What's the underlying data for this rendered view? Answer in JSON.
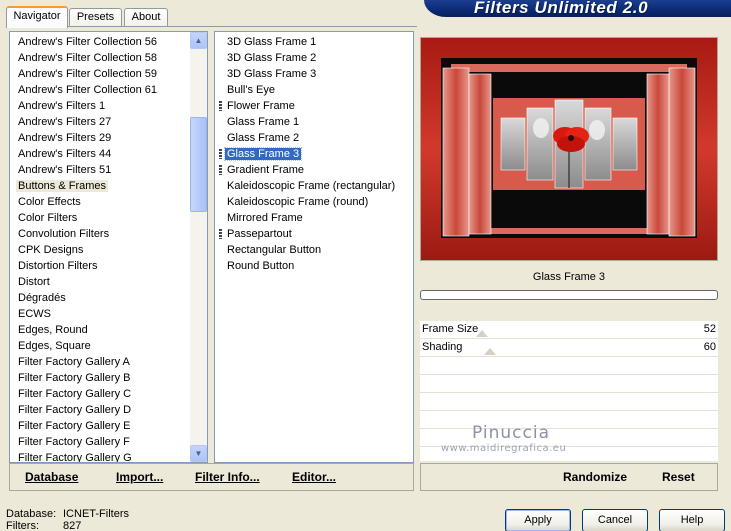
{
  "header": {
    "title": "Filters Unlimited 2.0"
  },
  "tabs": [
    {
      "label": "Navigator",
      "active": true
    },
    {
      "label": "Presets",
      "active": false
    },
    {
      "label": "About",
      "active": false
    }
  ],
  "categories": [
    "Andrew's Filter Collection 56",
    "Andrew's Filter Collection 58",
    "Andrew's Filter Collection 59",
    "Andrew's Filter Collection 61",
    "Andrew's Filters 1",
    "Andrew's Filters 27",
    "Andrew's Filters 29",
    "Andrew's Filters 44",
    "Andrew's Filters 51",
    "Buttons & Frames",
    "Color Effects",
    "Color Filters",
    "Convolution Filters",
    "CPK Designs",
    "Distortion Filters",
    "Distort",
    "Dégradés",
    "ECWS",
    "Edges, Round",
    "Edges, Square",
    "Filter Factory Gallery A",
    "Filter Factory Gallery B",
    "Filter Factory Gallery C",
    "Filter Factory Gallery D",
    "Filter Factory Gallery E",
    "Filter Factory Gallery F",
    "Filter Factory Gallery G"
  ],
  "selected_category": "Buttons & Frames",
  "filters": [
    {
      "label": "3D Glass Frame 1",
      "grip": false
    },
    {
      "label": "3D Glass Frame 2",
      "grip": false
    },
    {
      "label": "3D Glass Frame 3",
      "grip": false
    },
    {
      "label": "Bull's Eye",
      "grip": false
    },
    {
      "label": "Flower Frame",
      "grip": true
    },
    {
      "label": "Glass Frame 1",
      "grip": false
    },
    {
      "label": "Glass Frame 2",
      "grip": false
    },
    {
      "label": "Glass Frame 3",
      "grip": true
    },
    {
      "label": "Gradient Frame",
      "grip": true
    },
    {
      "label": "Kaleidoscopic Frame (rectangular)",
      "grip": false
    },
    {
      "label": "Kaleidoscopic Frame (round)",
      "grip": false
    },
    {
      "label": "Mirrored Frame",
      "grip": false
    },
    {
      "label": "Passepartout",
      "grip": true
    },
    {
      "label": "Rectangular Button",
      "grip": false
    },
    {
      "label": "Round Button",
      "grip": false
    }
  ],
  "selected_filter": "Glass Frame 3",
  "left_buttons": {
    "database": "Database",
    "import": "Import...",
    "filter_info": "Filter Info...",
    "editor": "Editor..."
  },
  "preview": {
    "label": "Glass Frame 3",
    "progress": 0
  },
  "params": [
    {
      "label": "Frame Size",
      "value": 52
    },
    {
      "label": "Shading",
      "value": 60
    }
  ],
  "watermark": {
    "title": "Pinuccia",
    "site": "www.maidiregrafica.eu"
  },
  "right_buttons": {
    "randomize": "Randomize",
    "reset": "Reset"
  },
  "status": {
    "database_label": "Database:",
    "database_value": "ICNET-Filters",
    "filters_label": "Filters:",
    "filters_value": "827"
  },
  "dialog_buttons": {
    "apply": "Apply",
    "cancel": "Cancel",
    "help": "Help"
  },
  "colors": {
    "selection_blue": "#316ac5",
    "banner_blue": "#0b2a74",
    "frame_red": "#c0392b"
  }
}
